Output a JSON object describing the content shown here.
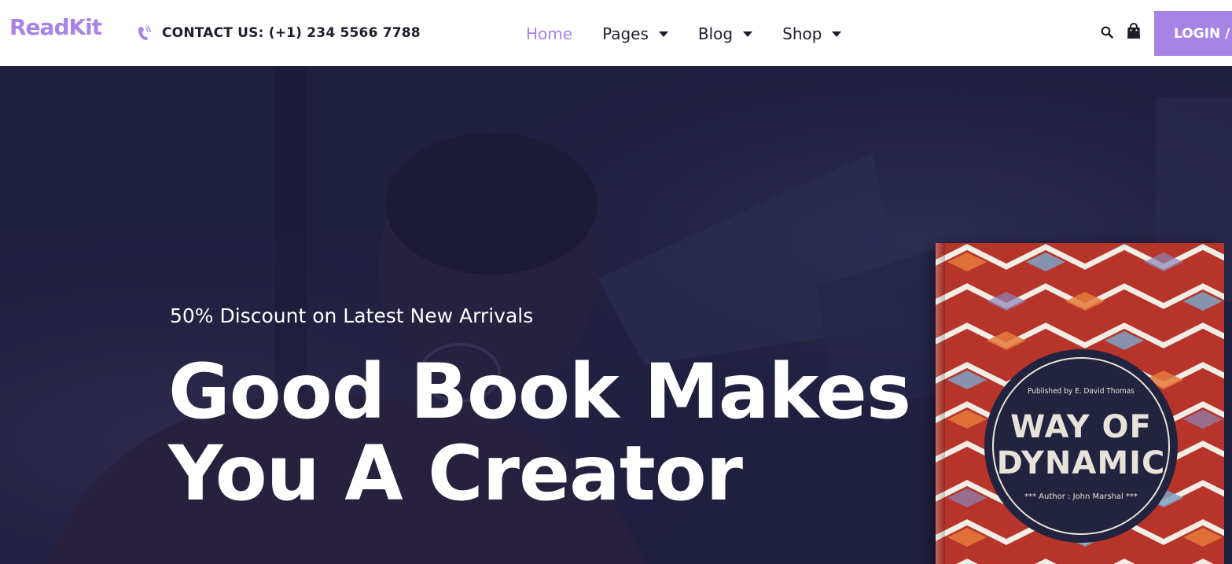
{
  "header": {
    "logo": "ReadKit",
    "contact": "CONTACT US: (+1) 234 5566 7788",
    "nav": [
      {
        "label": "Home",
        "active": true,
        "has_dropdown": false
      },
      {
        "label": "Pages",
        "active": false,
        "has_dropdown": true
      },
      {
        "label": "Blog",
        "active": false,
        "has_dropdown": true
      },
      {
        "label": "Shop",
        "active": false,
        "has_dropdown": true
      }
    ],
    "login_label": "LOGIN /",
    "icons": {
      "phone": "phone-icon",
      "search": "search-icon",
      "cart": "shopping-bag-icon"
    }
  },
  "hero": {
    "subtitle": "50% Discount on Latest New Arrivals",
    "headline_line1": "Good Book Makes",
    "headline_line2": "You A Creator"
  },
  "book": {
    "publisher": "Published by E. David Thomas",
    "title_line1": "WAY OF",
    "title_line2": "DYNAMIC",
    "author": "*** Author : John Marshal ***"
  },
  "colors": {
    "accent": "#a783e8",
    "nav_text": "#1d1d2b",
    "hero_overlay": "#222140",
    "book_badge": "#22233f",
    "book_red": "#b3362a"
  }
}
